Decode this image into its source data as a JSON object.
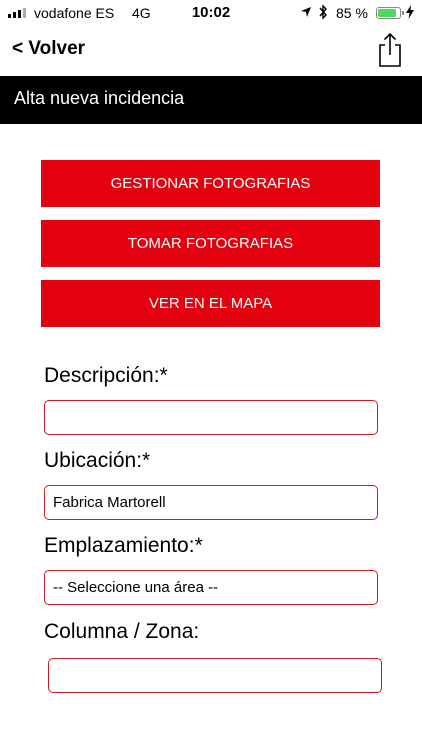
{
  "status_bar": {
    "carrier": "vodafone ES",
    "network": "4G",
    "time": "10:02",
    "battery_percent": "85 %",
    "battery_level": 0.85,
    "icons": [
      "signal-bars",
      "location-arrow",
      "bluetooth",
      "battery",
      "charging-bolt"
    ]
  },
  "nav": {
    "back_label": "< Volver",
    "share_icon": "share-icon"
  },
  "page": {
    "title": "Alta nueva incidencia"
  },
  "actions": {
    "manage_photos": "GESTIONAR FOTOGRAFIAS",
    "take_photos": "TOMAR FOTOGRAFIAS",
    "view_map": "VER EN EL MAPA"
  },
  "form": {
    "description": {
      "label": "Descripción:*",
      "value": ""
    },
    "location": {
      "label": "Ubicación:*",
      "value": "Fabrica Martorell"
    },
    "placement": {
      "label": "Emplazamiento:*",
      "value": "-- Seleccione una área --"
    },
    "column_zone": {
      "label": "Columna / Zona:",
      "value": ""
    }
  },
  "colors": {
    "accent_red": "#e3000f",
    "border_red": "#d51a23",
    "title_band": "#000000",
    "battery_green": "#4cd964"
  }
}
